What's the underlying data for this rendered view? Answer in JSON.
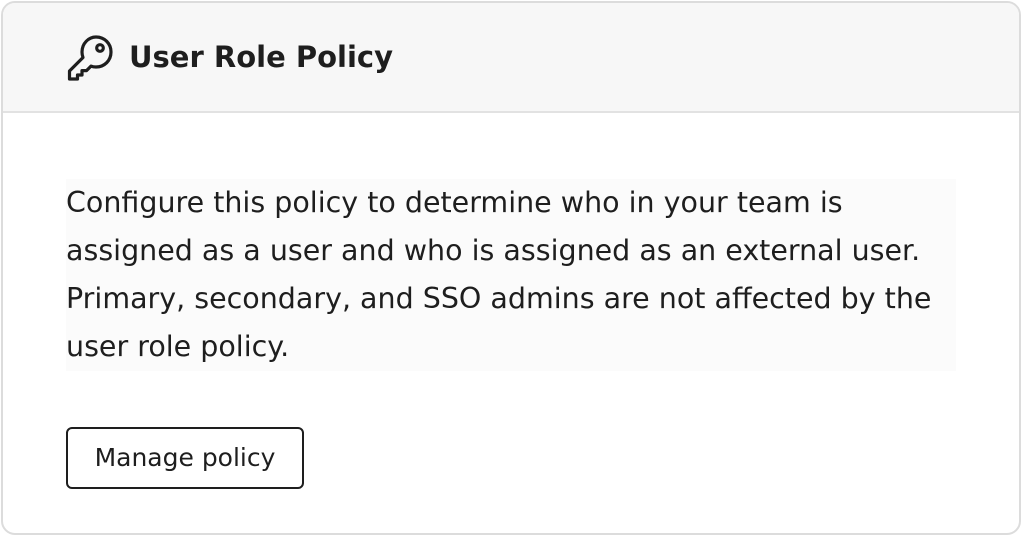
{
  "card": {
    "icon": "key-icon",
    "title": "User Role Policy",
    "description": "Configure this policy to determine who in your team is assigned as a user and who is assigned as an external user. Primary, secondary, and SSO admins are not affected by the user role policy.",
    "button_label": "Manage policy"
  }
}
